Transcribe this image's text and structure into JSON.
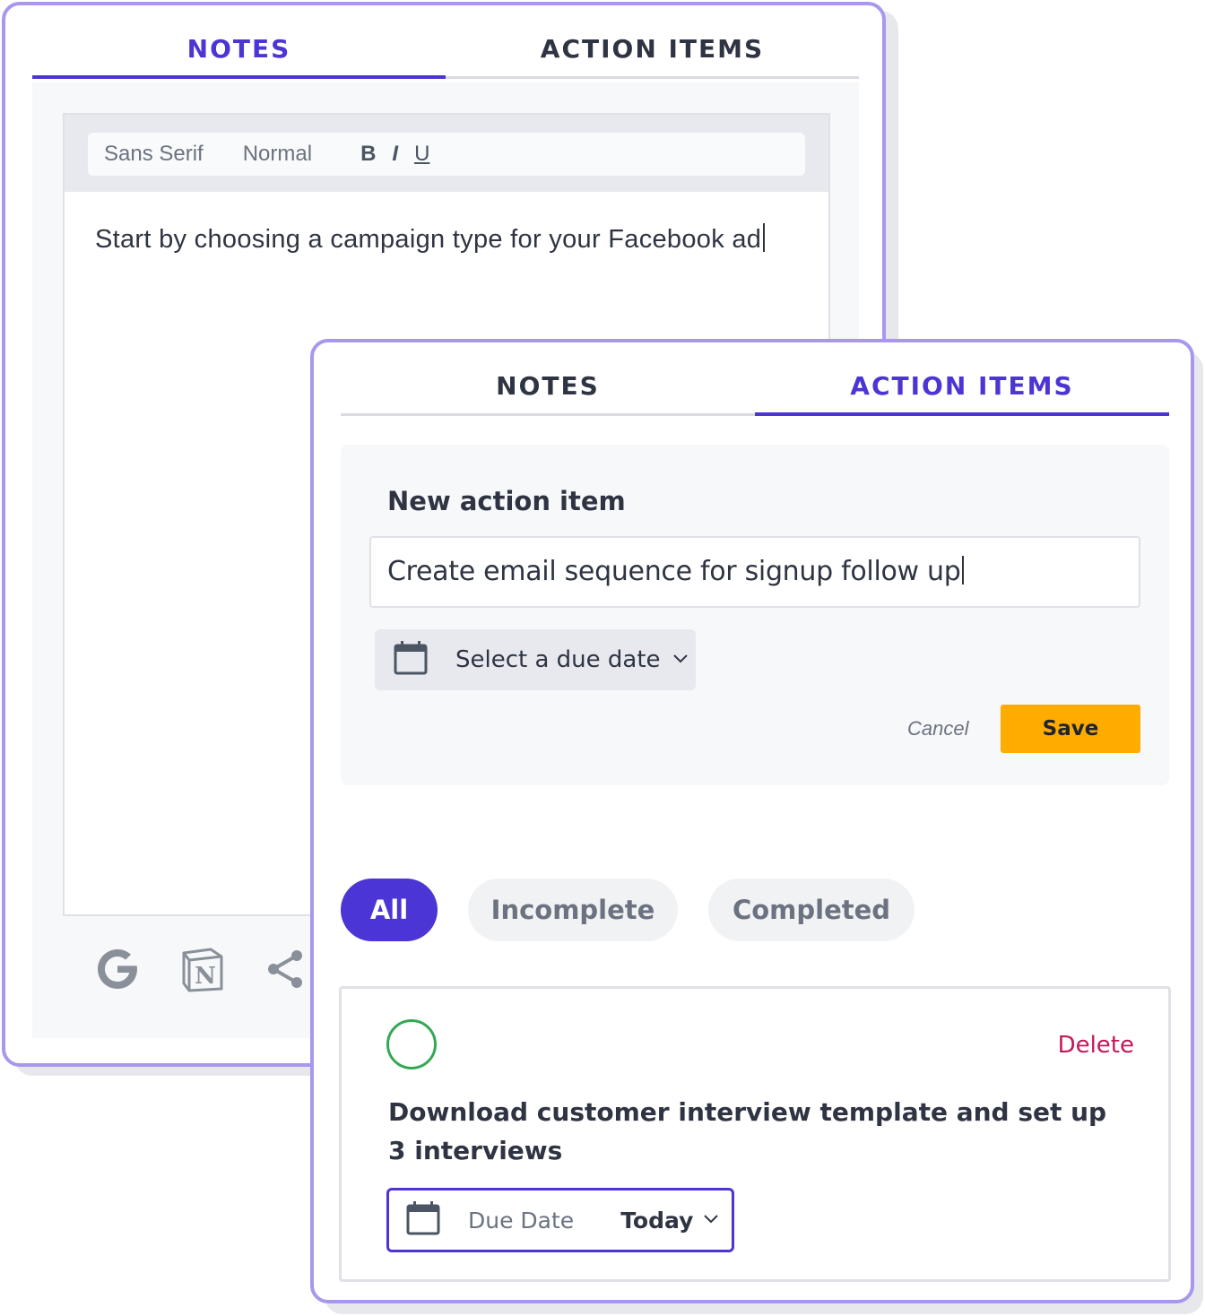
{
  "notes_panel": {
    "tabs": [
      "NOTES",
      "ACTION ITEMS"
    ],
    "active_tab": "NOTES",
    "toolbar": {
      "font": "Sans Serif",
      "size": "Normal",
      "bold": "B",
      "italic": "I",
      "underline": "U"
    },
    "editor_text": "Start by choosing a campaign type for your Facebook ad",
    "share_icons": [
      "google-icon",
      "notion-icon",
      "share-icon"
    ]
  },
  "action_panel": {
    "tabs": [
      "NOTES",
      "ACTION ITEMS"
    ],
    "active_tab": "ACTION ITEMS",
    "new_item": {
      "title": "New action item",
      "input_value": "Create email sequence for signup follow up",
      "due_select": "Select a due date",
      "cancel": "Cancel",
      "save": "Save"
    },
    "filters": [
      "All",
      "Incomplete",
      "Completed"
    ],
    "active_filter": "All",
    "task": {
      "title": "Download customer interview template and set up 3 interviews",
      "delete": "Delete",
      "due_label": "Due Date",
      "due_value": "Today",
      "completed": false
    }
  },
  "colors": {
    "accent": "#4b35d4",
    "panel_border": "#a997ef",
    "save_button": "#ffab00",
    "delete_text": "#c2185b",
    "checkbox": "#34a853"
  }
}
